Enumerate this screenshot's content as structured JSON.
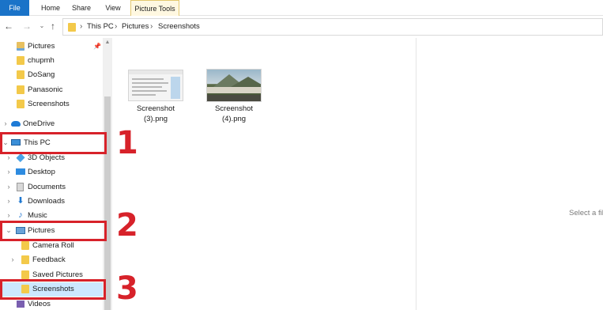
{
  "ribbon": {
    "tabs": [
      "File",
      "Home",
      "Share",
      "View",
      "Picture Tools"
    ]
  },
  "address": {
    "crumbs": [
      "This PC",
      "Pictures",
      "Screenshots"
    ]
  },
  "navpane": {
    "quick_access": [
      {
        "label": "Pictures",
        "pinned": true
      },
      {
        "label": "chupmh"
      },
      {
        "label": "DoSang"
      },
      {
        "label": "Panasonic"
      },
      {
        "label": "Screenshots"
      }
    ],
    "onedrive": "OneDrive",
    "this_pc": "This PC",
    "pc_items": [
      "3D Objects",
      "Desktop",
      "Documents",
      "Downloads",
      "Music"
    ],
    "pictures": "Pictures",
    "picture_children": [
      "Camera Roll",
      "Feedback",
      "Saved Pictures",
      "Screenshots"
    ],
    "videos": "Videos"
  },
  "files": [
    {
      "name": "Screenshot\n(3).png",
      "line1": "Screenshot",
      "line2": "(3).png"
    },
    {
      "name": "Screenshot\n(4).png",
      "line1": "Screenshot",
      "line2": "(4).png"
    }
  ],
  "preview": {
    "text": "Select a fil"
  },
  "annotations": [
    "1",
    "2",
    "3"
  ],
  "colors": {
    "accent": "#1a73c8",
    "annotation": "#d7222a",
    "selection": "#cce8ff",
    "folder": "#f3c94a"
  }
}
